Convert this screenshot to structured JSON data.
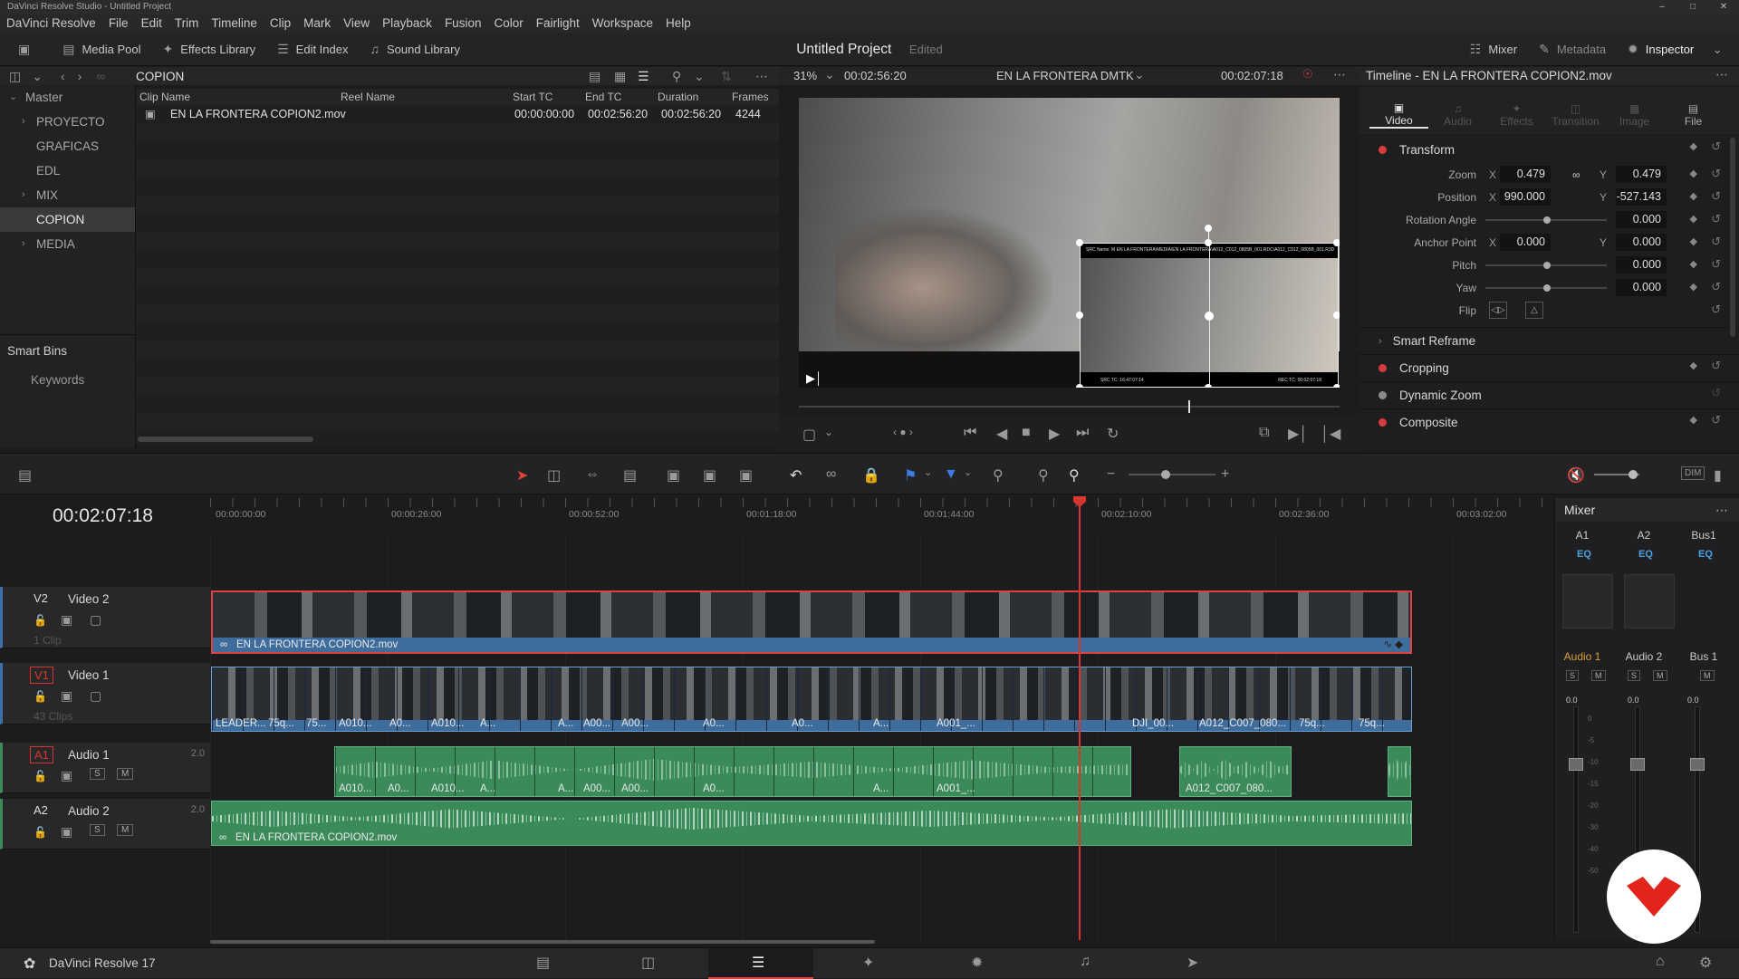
{
  "window": {
    "title": "DaVinci Resolve Studio - Untitled Project"
  },
  "menu": [
    "DaVinci Resolve",
    "File",
    "Edit",
    "Trim",
    "Timeline",
    "Clip",
    "Mark",
    "View",
    "Playback",
    "Fusion",
    "Color",
    "Fairlight",
    "Workspace",
    "Help"
  ],
  "toolbar": {
    "media_pool": "Media Pool",
    "effects_library": "Effects Library",
    "edit_index": "Edit Index",
    "sound_library": "Sound Library",
    "project_title": "Untitled Project",
    "project_status": "Edited",
    "mixer": "Mixer",
    "metadata": "Metadata",
    "inspector": "Inspector"
  },
  "bins": {
    "current": "COPION",
    "items": [
      {
        "label": "Master",
        "chevron": "v"
      },
      {
        "label": "PROYECTO",
        "chevron": ">"
      },
      {
        "label": "GRAFICAS",
        "chevron": ""
      },
      {
        "label": "EDL",
        "chevron": ""
      },
      {
        "label": "MIX",
        "chevron": ">"
      },
      {
        "label": "COPION",
        "chevron": ""
      },
      {
        "label": "MEDIA",
        "chevron": ">"
      }
    ],
    "smart_bins": "Smart Bins",
    "keywords": "Keywords"
  },
  "pool": {
    "columns": [
      "Clip Name",
      "Reel Name",
      "Start TC",
      "End TC",
      "Duration",
      "Frames"
    ],
    "rows": [
      {
        "name": "EN LA FRONTERA COPION2.mov",
        "reel": "",
        "start": "00:00:00:00",
        "end": "00:02:56:20",
        "duration": "00:02:56:20",
        "frames": "4244"
      }
    ]
  },
  "viewer": {
    "zoom": "31%",
    "source_tc": "00:02:56:20",
    "timeline_name": "EN LA FRONTERA DMTK",
    "record_tc": "00:02:07:18",
    "overlay_top": "SRC Name: M EN LA FRONTERA\\MEDIA\\EN LA FRONTERA\\A012_C012_0805B_001.RDC\\A012_C012_0805B_001.R3D",
    "overlay_src_tc": "SRC TC: 16:47:07:14",
    "overlay_rec_tc": "REC TC: 00:02:07:18"
  },
  "inspector": {
    "title": "Timeline - EN LA FRONTERA COPION2.mov",
    "tabs": [
      "Video",
      "Audio",
      "Effects",
      "Transition",
      "Image",
      "File"
    ],
    "transform": "Transform",
    "zoom_label": "Zoom",
    "zoom_x": "0.479",
    "zoom_y": "0.479",
    "position_label": "Position",
    "position_x": "990.000",
    "position_y": "-527.143",
    "rotation_label": "Rotation Angle",
    "rotation": "0.000",
    "anchor_label": "Anchor Point",
    "anchor_x": "0.000",
    "anchor_y": "0.000",
    "pitch_label": "Pitch",
    "pitch": "0.000",
    "yaw_label": "Yaw",
    "yaw": "0.000",
    "flip_label": "Flip",
    "axis_x": "X",
    "axis_y": "Y",
    "smart_reframe": "Smart Reframe",
    "cropping": "Cropping",
    "dynamic_zoom": "Dynamic Zoom",
    "composite": "Composite"
  },
  "timeline": {
    "timecode": "00:02:07:18",
    "ruler": [
      "00:00:00:00",
      "00:00:26:00",
      "00:00:52:00",
      "00:01:18:00",
      "00:01:44:00",
      "00:02:10:00",
      "00:02:36:00",
      "00:03:02:00"
    ],
    "tracks": {
      "v2": {
        "id": "V2",
        "name": "Video 2",
        "count": "1 Clip",
        "clip": "EN LA FRONTERA COPION2.mov"
      },
      "v1": {
        "id": "V1",
        "name": "Video 1",
        "count": "43 Clips"
      },
      "a1": {
        "id": "A1",
        "name": "Audio 1",
        "level": "2.0"
      },
      "a2": {
        "id": "A2",
        "name": "Audio 2",
        "level": "2.0",
        "clip": "EN LA FRONTERA COPION2.mov"
      }
    },
    "v1_labels": [
      "LEADER...",
      "75q...",
      "75...",
      "A010...",
      "A0...",
      "A010...",
      "A...",
      "A...",
      "A00...",
      "A00...",
      "A0...",
      "A0...",
      "A...",
      "A001_...",
      "DJI_00...",
      "A012_C007_080...",
      "75q...",
      "75q..."
    ],
    "a1_labels": [
      "A010...",
      "A0...",
      "A010...",
      "A...",
      "A...",
      "A00...",
      "A00...",
      "A0...",
      "A...",
      "A001_...",
      "A012_C007_080..."
    ]
  },
  "mixer": {
    "title": "Mixer",
    "channels": [
      "A1",
      "A2",
      "Bus1"
    ],
    "names": [
      "Audio 1",
      "Audio 2",
      "Bus 1"
    ],
    "eq": "EQ",
    "db": [
      "0.0",
      "0.0",
      "0.0"
    ],
    "scale": [
      "0",
      "-5",
      "-10",
      "-15",
      "-20",
      "-30",
      "-40",
      "-50"
    ]
  },
  "footer": {
    "app": "DaVinci Resolve 17"
  }
}
